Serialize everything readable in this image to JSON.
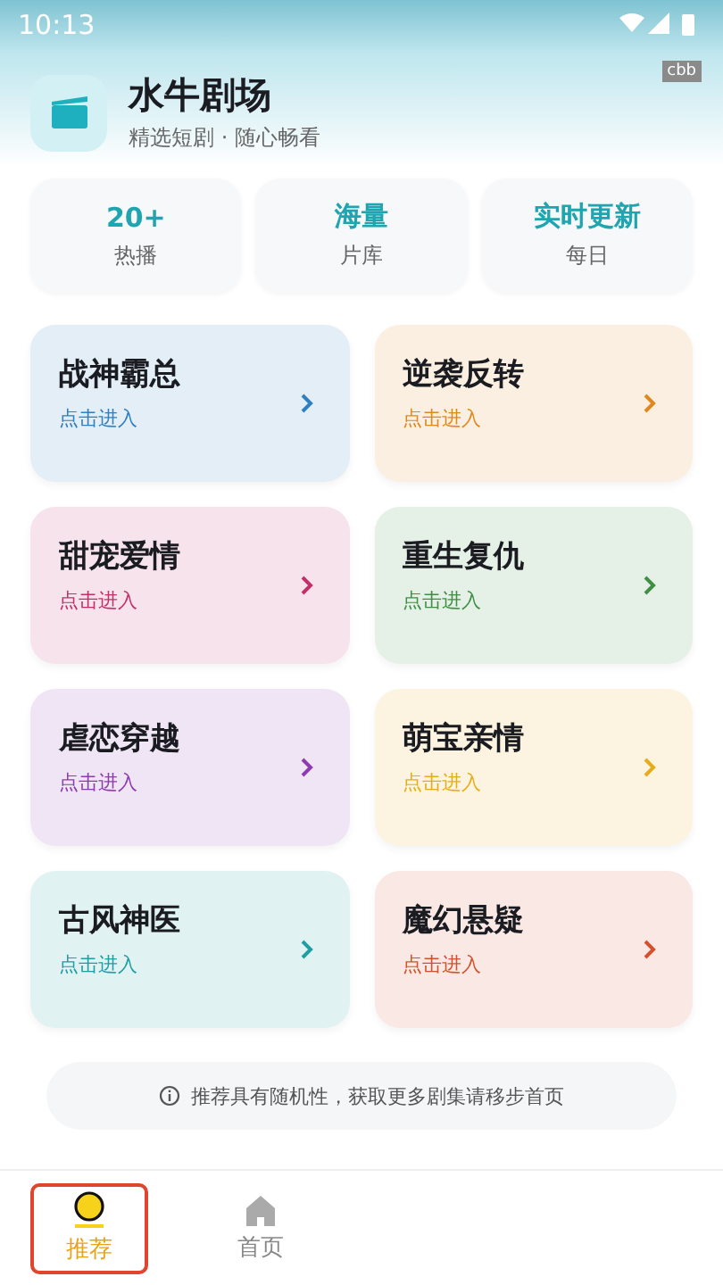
{
  "status_bar": {
    "time": "10:13"
  },
  "header": {
    "title": "水牛剧场",
    "subtitle": "精选短剧 · 随心畅看",
    "tag": "cbb"
  },
  "stats": [
    {
      "value": "20+",
      "label": "热播"
    },
    {
      "value": "海量",
      "label": "片库"
    },
    {
      "value": "实时更新",
      "label": "每日"
    }
  ],
  "genres": [
    {
      "title": "战神霸总",
      "action": "点击进入",
      "color": "#2f7fc1"
    },
    {
      "title": "逆袭反转",
      "action": "点击进入",
      "color": "#e0871e"
    },
    {
      "title": "甜宠爱情",
      "action": "点击进入",
      "color": "#c2306a"
    },
    {
      "title": "重生复仇",
      "action": "点击进入",
      "color": "#3f8f45"
    },
    {
      "title": "虐恋穿越",
      "action": "点击进入",
      "color": "#8e3bb0"
    },
    {
      "title": "萌宝亲情",
      "action": "点击进入",
      "color": "#e6ad1a"
    },
    {
      "title": "古风神医",
      "action": "点击进入",
      "color": "#1f9ea3"
    },
    {
      "title": "魔幻悬疑",
      "action": "点击进入",
      "color": "#d2522e"
    }
  ],
  "notice": "推荐具有随机性，获取更多剧集请移步首页",
  "tabs": [
    {
      "label": "推荐",
      "kind": "recommend",
      "selected": true,
      "highlighted": true
    },
    {
      "label": "首页",
      "kind": "home",
      "selected": false,
      "highlighted": false
    }
  ]
}
